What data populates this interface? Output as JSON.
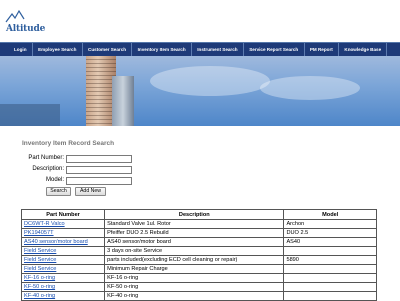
{
  "header": {
    "logo_text": "Altitude"
  },
  "nav": [
    "Login",
    "Employee Search",
    "Customer Search",
    "Inventory Item Search",
    "Instrument Search",
    "Service Report Search",
    "PM Report",
    "Knowledge Base"
  ],
  "page_title": "Inventory Item Record Search",
  "form": {
    "part_number_label": "Part Number:",
    "part_number_value": "",
    "description_label": "Description:",
    "description_value": "",
    "model_label": "Model:",
    "model_value": "",
    "search_button": "Search",
    "add_new_button": "Add New"
  },
  "table": {
    "columns": [
      "Part Number",
      "Description",
      "Model"
    ],
    "rows": [
      [
        "DC6WT-R Valco",
        "Standard Valve 1ul. Rotor",
        "Archon"
      ],
      [
        "PK194057T",
        "Pfeiffer DUO 2.5 Rebuild",
        "DUO 2.5"
      ],
      [
        "AS40 sensor/motor board",
        "AS40 sensor/motor board",
        "AS40"
      ],
      [
        "Field Service",
        "3 days on-site Service",
        ""
      ],
      [
        "Field Service",
        "parts included(excluding ECD cell cleaning or repair)",
        "5890"
      ],
      [
        "Field Service",
        "Minimum Repair Charge",
        ""
      ],
      [
        "KF-16 o-ring",
        "KF-16 o-ring",
        ""
      ],
      [
        "KF-50 o-ring",
        "KF-50 o-ring",
        ""
      ],
      [
        "KF-40 o-ring",
        "KF-40 o-ring",
        ""
      ]
    ]
  },
  "colors": {
    "nav_bg": "#1e3a78",
    "link": "#1a4fb0",
    "title": "#777777"
  }
}
